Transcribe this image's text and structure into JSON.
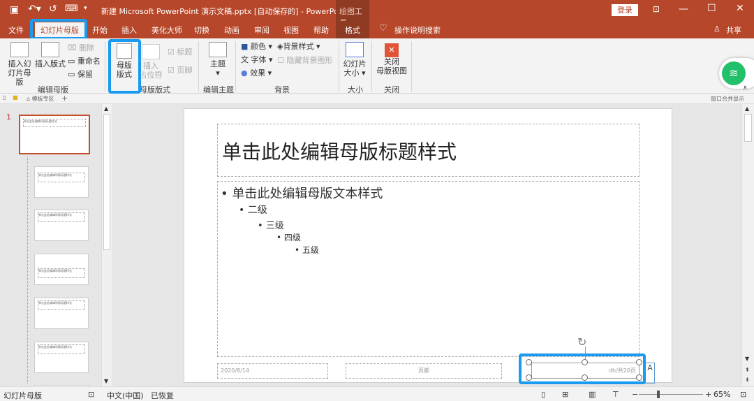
{
  "titlebar": {
    "title": "新建 Microsoft PowerPoint 演示文稿.pptx [自动保存的]  -  PowerPoint",
    "context_tool": "绘图工具",
    "login": "登录"
  },
  "tabs": [
    {
      "label": "文件"
    },
    {
      "label": "幻灯片母版",
      "active": true
    },
    {
      "label": "开始"
    },
    {
      "label": "插入"
    },
    {
      "label": "美化大师"
    },
    {
      "label": "切换"
    },
    {
      "label": "动画"
    },
    {
      "label": "审阅"
    },
    {
      "label": "视图"
    },
    {
      "label": "帮助"
    },
    {
      "label": "格式"
    }
  ],
  "search": "操作说明搜索",
  "share": "共享",
  "ribbon": {
    "insert_master": "插入幻\n灯片母版",
    "insert_layout": "插入版式",
    "delete": "删除",
    "rename": "重命名",
    "preserve": "保留",
    "group_edit_master": "编辑母版",
    "master_layout": "母版\n版式",
    "insert_placeholder": "插入\n占位符",
    "title_check": "标题",
    "footer_check": "页脚",
    "group_master_layout": "母版版式",
    "theme": "主题",
    "group_edit_theme": "编辑主题",
    "colors": "颜色",
    "fonts": "字体",
    "effects": "效果",
    "bg_styles": "背景样式",
    "hide_bg": "隐藏背景图形",
    "group_background": "背景",
    "slide_size": "幻灯片\n大小",
    "group_size": "大小",
    "close_master": "关闭\n母版视图",
    "group_close": "关闭"
  },
  "docbar": {
    "tab": "模板专区",
    "merge": "窗口合并显示"
  },
  "thumbnails": {
    "first_number": "1",
    "first_title": "单击此处编辑母版标题样式",
    "layout_titles": [
      "单击此处编辑母版标题样式",
      "单击此处编辑母版标题样式",
      "单击此处编辑母版标题样式",
      "单击此处编辑母版标题样式",
      "单击此处编辑母版标题样式"
    ]
  },
  "slide": {
    "title": "单击此处编辑母版标题样式",
    "levels": [
      "单击此处编辑母版文本样式",
      "二级",
      "三级",
      "四级",
      "五级"
    ],
    "date": "2020/8/14",
    "footer": "页脚",
    "page_number": "dh/共20页"
  },
  "status": {
    "view": "幻灯片母版",
    "language": "中文(中国)",
    "recovered": "已恢复",
    "zoom": "65%",
    "zoom_percent": 65
  },
  "colors": {
    "accent": "#b7472a",
    "highlight": "#1a9bf0"
  }
}
